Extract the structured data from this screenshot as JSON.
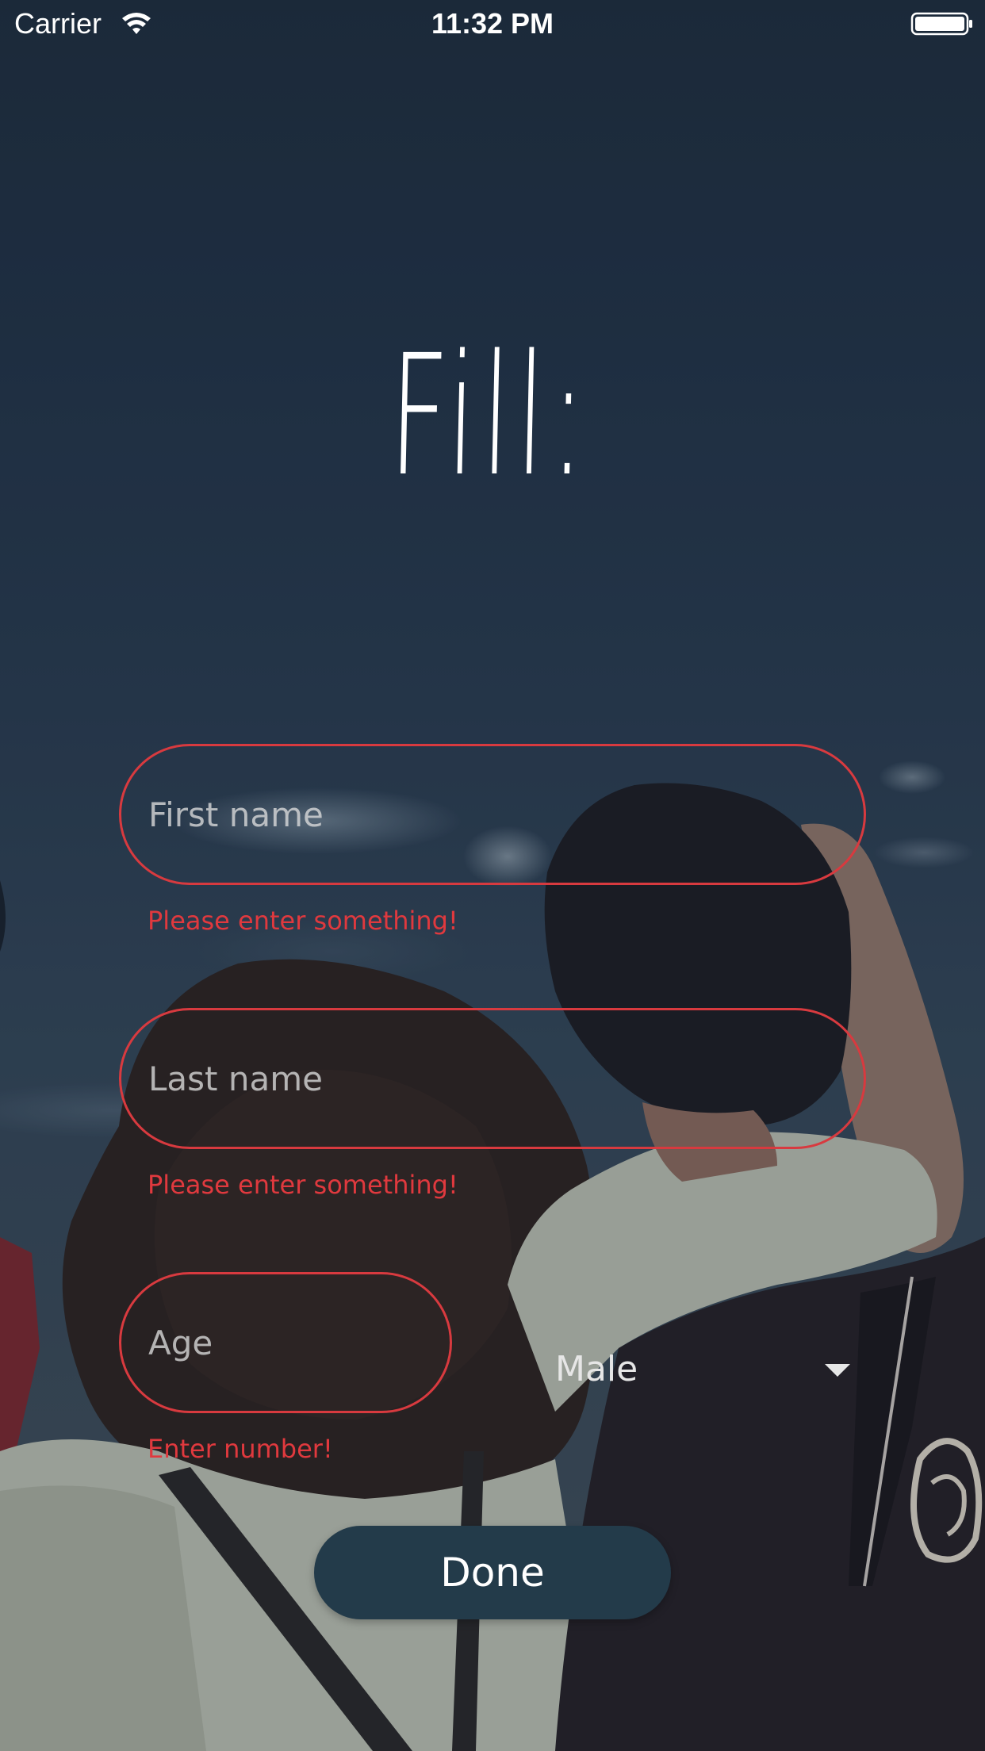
{
  "status_bar": {
    "carrier": "Carrier",
    "time": "11:32 PM",
    "wifi_icon": "wifi-icon",
    "battery_icon": "battery-icon"
  },
  "title": "Fill:",
  "form": {
    "first_name": {
      "placeholder": "First name",
      "value": "",
      "error": "Please enter something!"
    },
    "last_name": {
      "placeholder": "Last name",
      "value": "",
      "error": "Please enter something!"
    },
    "age": {
      "placeholder": "Age",
      "value": "",
      "error": "Enter number!"
    },
    "gender": {
      "selected": "Male",
      "icon": "chevron-down-icon"
    },
    "done_label": "Done"
  },
  "colors": {
    "error": "#e0393e",
    "field_border": "#d83a3f",
    "button_bg": "#233b4a",
    "text": "#ffffff"
  }
}
